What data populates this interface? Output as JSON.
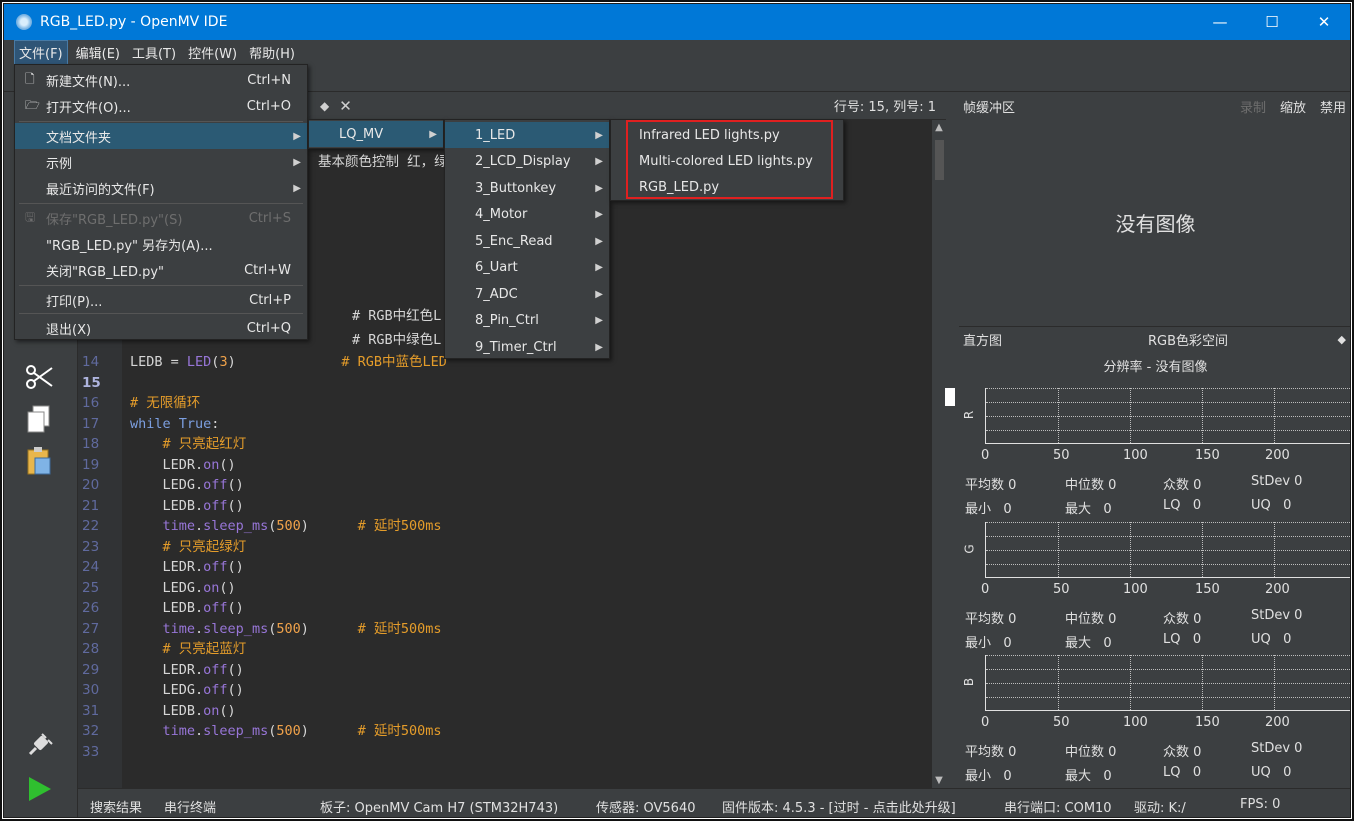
{
  "window": {
    "title": "RGB_LED.py - OpenMV IDE",
    "minimize": "—",
    "maximize": "☐",
    "close": "✕"
  },
  "menubar": [
    "文件(F)",
    "编辑(E)",
    "工具(T)",
    "控件(W)",
    "帮助(H)"
  ],
  "file_menu": {
    "items": [
      {
        "label": "新建文件(N)...",
        "shortcut": "Ctrl+N",
        "icon": "new-file-icon"
      },
      {
        "label": "打开文件(O)...",
        "shortcut": "Ctrl+O",
        "icon": "open-folder-icon"
      },
      {
        "label": "文档文件夹",
        "submenu": true
      },
      {
        "label": "示例",
        "submenu": true
      },
      {
        "label": "最近访问的文件(F)",
        "submenu": true
      },
      {
        "label": "保存\"RGB_LED.py\"(S)",
        "shortcut": "Ctrl+S",
        "disabled": true,
        "icon": "save-icon"
      },
      {
        "label": "\"RGB_LED.py\" 另存为(A)...",
        "shortcut": ""
      },
      {
        "label": "关闭\"RGB_LED.py\"",
        "shortcut": "Ctrl+W"
      },
      {
        "label": "打印(P)...",
        "shortcut": "Ctrl+P"
      },
      {
        "label": "退出(X)",
        "shortcut": "Ctrl+Q"
      }
    ]
  },
  "docs_submenu": [
    "LQ_MV"
  ],
  "lqmv_submenu": [
    "1_LED",
    "2_LCD_Display",
    "3_Buttonkey",
    "4_Motor",
    "5_Enc_Read",
    "6_Uart",
    "7_ADC",
    "8_Pin_Ctrl",
    "9_Timer_Ctrl"
  ],
  "led_submenu": [
    "Infrared LED lights.py",
    "Multi-colored LED lights.py",
    "RGB_LED.py"
  ],
  "editor": {
    "position": "行号: 15, 列号: 1",
    "partial_comment": "基本颜色控制 红，绿",
    "lines": [
      {
        "n": "14",
        "code": "LEDB = LED(3)             # RGB中蓝色LED"
      },
      {
        "n": "15",
        "code": ""
      },
      {
        "n": "16",
        "code": "# 无限循环"
      },
      {
        "n": "17",
        "code": "while True:"
      },
      {
        "n": "18",
        "code": "    # 只亮起红灯"
      },
      {
        "n": "19",
        "code": "    LEDR.on()"
      },
      {
        "n": "20",
        "code": "    LEDG.off()"
      },
      {
        "n": "21",
        "code": "    LEDB.off()"
      },
      {
        "n": "22",
        "code": "    time.sleep_ms(500)      # 延时500ms"
      },
      {
        "n": "23",
        "code": "    # 只亮起绿灯"
      },
      {
        "n": "24",
        "code": "    LEDR.off()"
      },
      {
        "n": "25",
        "code": "    LEDG.on()"
      },
      {
        "n": "26",
        "code": "    LEDB.off()"
      },
      {
        "n": "27",
        "code": "    time.sleep_ms(500)      # 延时500ms"
      },
      {
        "n": "28",
        "code": "    # 只亮起蓝灯"
      },
      {
        "n": "29",
        "code": "    LEDR.off()"
      },
      {
        "n": "30",
        "code": "    LEDG.off()"
      },
      {
        "n": "31",
        "code": "    LEDB.on()"
      },
      {
        "n": "32",
        "code": "    time.sleep_ms(500)      # 延时500ms"
      },
      {
        "n": "33",
        "code": ""
      }
    ],
    "hidden_fragments": [
      {
        "code": "# RGB中红色L"
      },
      {
        "code": "# RGB中绿色L"
      }
    ]
  },
  "framebuffer": {
    "title": "帧缓冲区",
    "actions": [
      "录制",
      "缩放",
      "禁用"
    ],
    "no_image": "没有图像"
  },
  "histogram": {
    "title": "直方图",
    "colorspace": "RGB色彩空间",
    "resolution": "分辨率 - 没有图像",
    "ticks": [
      "0",
      "50",
      "100",
      "150",
      "200"
    ],
    "channels": [
      "R",
      "G",
      "B"
    ],
    "stats_row1": [
      "平均数 0",
      "中位数 0",
      "众数 0",
      "StDev 0"
    ],
    "stats_row2": [
      "最小   0",
      "最大   0",
      "LQ   0",
      "UQ   0"
    ]
  },
  "statusbar": {
    "search": "搜索结果",
    "serial_terminal": "串行终端",
    "board": "板子: OpenMV Cam H7 (STM32H743)",
    "sensor": "传感器: OV5640",
    "firmware": "固件版本: 4.5.3 - [过时 - 点击此处升级]",
    "port": "串行端口: COM10",
    "drive": "驱动: K:/",
    "fps": "FPS: 0"
  },
  "colors": {
    "titlebar": "#0078d7",
    "panel": "#3c3f41",
    "editor_bg": "#2b2b2b",
    "menu_highlight": "#2b5a74",
    "callout": "#e02020"
  }
}
